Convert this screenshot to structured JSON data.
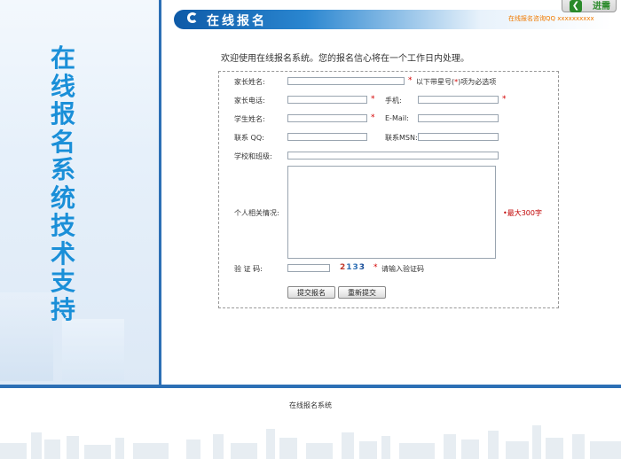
{
  "sidebar": {
    "title": "在线报名系统技术支持"
  },
  "header": {
    "title": "在线报名",
    "contact": "在线报名咨询QQ xxxxxxxxxx",
    "next_label": "进需"
  },
  "welcome": "欢迎使用在线报名系统。您的报名信心将在一个工作日内处理。",
  "form": {
    "parent_name_label": "家长姓名:",
    "required_note_pre": "以下带星号(",
    "required_note_star": "*",
    "required_note_post": ")项为必选项",
    "parent_phone_label": "家长电话:",
    "mobile_label": "手机:",
    "student_name_label": "学生姓名:",
    "email_label": "E-Mail:",
    "qq_label": "联系  QQ:",
    "msn_label": "联系MSN:",
    "school_label": "学校和班级:",
    "info_label": "个人相关情况:",
    "max_note": "•最大300字",
    "captcha_label": "验 证 码:",
    "captcha_chars": [
      "2",
      "1",
      "3",
      "3"
    ],
    "captcha_hint": "请输入验证码",
    "required_mark": "*",
    "submit_label": "提交报名",
    "reset_label": "重新提交"
  },
  "footer": {
    "text": "在线报名系统"
  }
}
